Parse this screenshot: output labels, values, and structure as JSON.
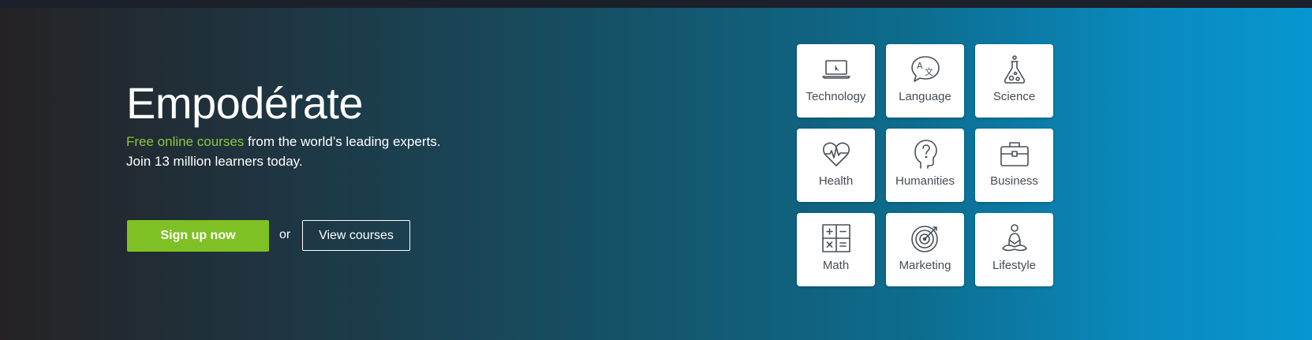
{
  "hero": {
    "title": "Empodérate",
    "tagline_accent": "Free online courses",
    "tagline_rest": " from the world’s leading experts.",
    "tagline_line2": "Join 13 million learners today.",
    "signup_label": "Sign up now",
    "or_label": "or",
    "view_label": "View courses"
  },
  "categories": [
    {
      "label": "Technology",
      "icon": "laptop-icon"
    },
    {
      "label": "Language",
      "icon": "translate-bubble-icon"
    },
    {
      "label": "Science",
      "icon": "flask-icon"
    },
    {
      "label": "Health",
      "icon": "heart-pulse-icon"
    },
    {
      "label": "Humanities",
      "icon": "head-question-icon"
    },
    {
      "label": "Business",
      "icon": "briefcase-icon"
    },
    {
      "label": "Math",
      "icon": "calculator-icon"
    },
    {
      "label": "Marketing",
      "icon": "target-icon"
    },
    {
      "label": "Lifestyle",
      "icon": "meditation-icon"
    }
  ],
  "colors": {
    "accent_green": "#7fc124",
    "tagline_green": "#8cc63f",
    "tile_text": "#444c55",
    "gradient_start": "#242224",
    "gradient_end": "#0796cf"
  }
}
